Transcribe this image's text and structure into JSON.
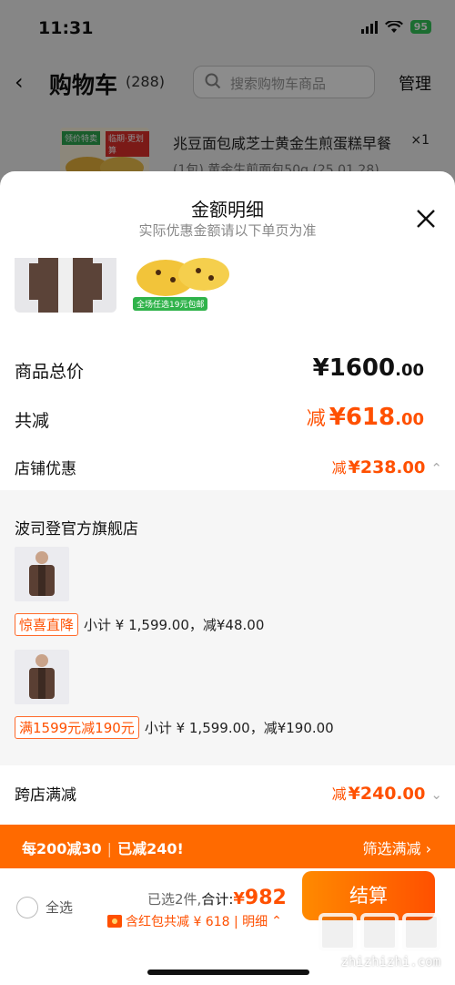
{
  "status_bar": {
    "time": "11:31",
    "battery": "95"
  },
  "nav": {
    "title": "购物车",
    "count": "(288)",
    "search_placeholder": "搜索购物车商品",
    "manage": "管理"
  },
  "bg_product": {
    "tag_left": "领价特卖",
    "tag_right": "临期·更划算",
    "title": "兆豆面包咸芝士黄金生煎蛋糕早餐",
    "qty": "×1",
    "sku": "(1包) 黄金生煎面包50g (25.01.28)"
  },
  "sheet": {
    "title": "金额明细",
    "subtitle": "实际优惠金额请以下单页为准",
    "bun_promo": "全场任选19元包邮"
  },
  "summary": {
    "total_label": "商品总价",
    "total_main": "¥1600",
    "total_dec": ".00",
    "reduce_label": "共减",
    "reduce_prefix": "减",
    "reduce_main": "¥618",
    "reduce_dec": ".00",
    "shop_label": "店铺优惠",
    "shop_prefix": "减",
    "shop_main": "¥238",
    "shop_dec": ".00",
    "cross_label": "跨店满减",
    "cross_prefix": "减",
    "cross_main": "¥240",
    "cross_dec": ".00"
  },
  "store": {
    "name": "波司登官方旗舰店",
    "items": [
      {
        "tag": "惊喜直降",
        "text": "小计 ¥ 1,599.00，减¥48.00"
      },
      {
        "tag": "满1599元减190元",
        "text": "小计 ¥ 1,599.00，减¥190.00"
      }
    ]
  },
  "banner": {
    "rule": "每200减30",
    "reduced": "已减240!",
    "filter": "筛选满减"
  },
  "bottom": {
    "select_all": "全选",
    "selected": "已选2件,",
    "total_label": "合计:",
    "amount_sym": "¥",
    "amount": "982",
    "hongbao": "含红包共减 ¥ 618 | 明细",
    "checkout": "结算"
  },
  "watermark": {
    "text": "zhizhizhi.com"
  },
  "colors": {
    "accent": "#ff5000",
    "banner": "#ff6a00",
    "battery": "#34c759",
    "bun_promo": "#2fb34a"
  }
}
